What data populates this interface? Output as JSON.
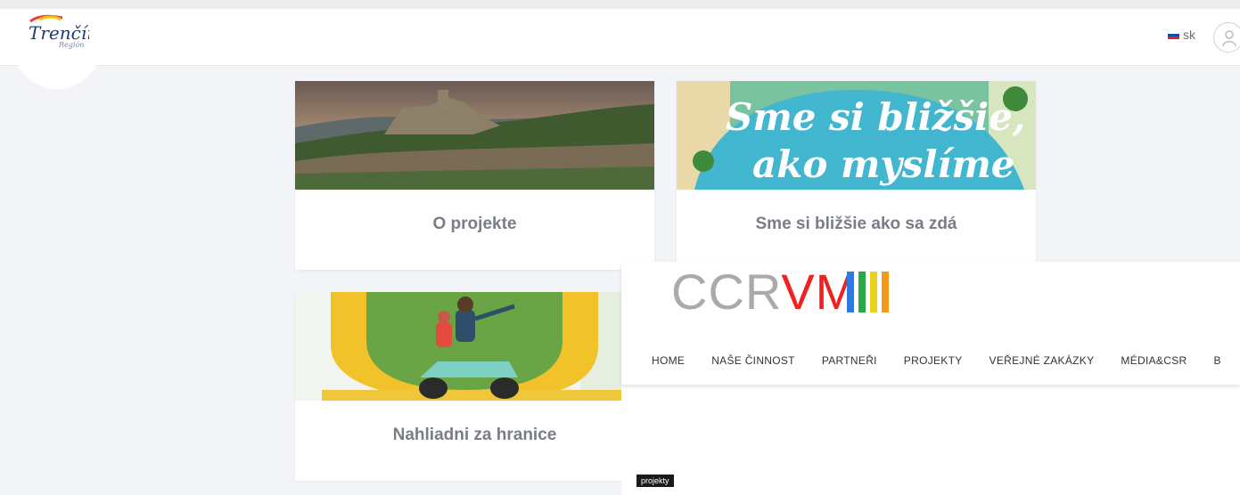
{
  "header": {
    "logo_text": "Trenčín",
    "logo_sub": "Región",
    "lang_label": "sk"
  },
  "cards": [
    {
      "title": "O projekte"
    },
    {
      "title": "Sme si bližšie ako sa zdá",
      "image_text_line1": "Sme si bližšie,",
      "image_text_line2": "ako myslíme"
    },
    {
      "title": "Nahliadni za hranice"
    }
  ],
  "overlay": {
    "brand_left": "CCR",
    "brand_red": "VM",
    "bar_colors": [
      "#2c7be5",
      "#2aa84a",
      "#e8d21a",
      "#f39a1a"
    ],
    "nav": [
      "HOME",
      "NAŠE ČINNOST",
      "PARTNEŘI",
      "PROJEKTY",
      "VEŘEJNÉ ZAKÁZKY",
      "MÉDIA&CSR",
      "B"
    ],
    "tag": "projekty"
  },
  "colors": {
    "card_title": "#797d86",
    "background": "#f3f4f7",
    "brand_red": "#ef2222"
  }
}
